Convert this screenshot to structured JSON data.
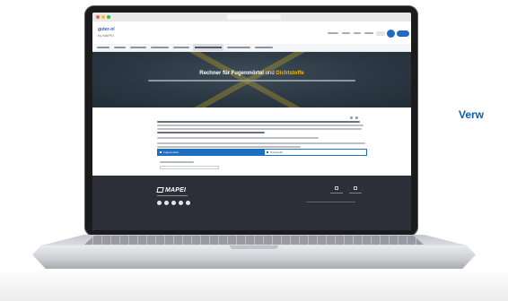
{
  "side_label": "Verw",
  "site": {
    "logo_main": "guter-ol",
    "logo_sub": "by MAPEI"
  },
  "hero": {
    "title_main": "Rechner für Fugenmörtel",
    "title_connector": "und",
    "title_accent": "Dichtstoffe"
  },
  "tabs": {
    "primary": "Fugenmörtel",
    "secondary": "Dichtstoffe"
  },
  "footer": {
    "brand": "MAPEI"
  },
  "colors": {
    "brand_blue": "#1f6fbe",
    "hero_background": "#2b3843",
    "accent_yellow": "#f2b705",
    "footer_background": "#2c2f37",
    "side_label": "#0b5bb5"
  },
  "icons": [
    "search-icon",
    "user-icon",
    "facebook-icon",
    "instagram-icon",
    "youtube-icon",
    "linkedin-icon",
    "pinterest-icon",
    "location-icon",
    "phone-icon"
  ]
}
